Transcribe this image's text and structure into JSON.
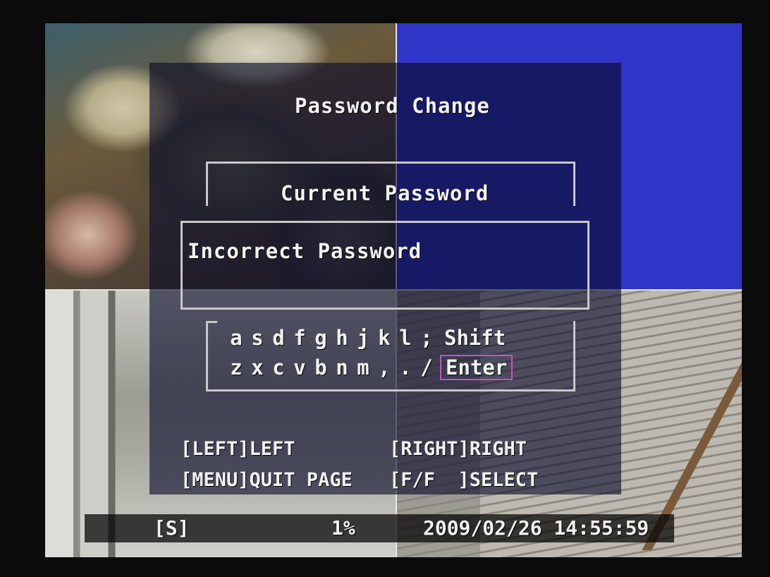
{
  "osd": {
    "title": "Password Change",
    "current_label": "Current Password",
    "password_value": "Incorrect Password"
  },
  "keyboard": {
    "row1": [
      "a",
      "s",
      "d",
      "f",
      "g",
      "h",
      "j",
      "k",
      "l",
      ";"
    ],
    "row1_shift": "Shift",
    "row2": [
      "z",
      "x",
      "c",
      "v",
      "b",
      "n",
      "m",
      ",",
      ".",
      "/"
    ],
    "row2_enter": "Enter"
  },
  "help": {
    "left": "[LEFT]LEFT",
    "right": "[RIGHT]RIGHT",
    "menu": "[MENU]QUIT PAGE",
    "select": "[F/F  ]SELECT"
  },
  "status": {
    "mode": "[S]",
    "usage": "1%",
    "datetime": "2009/02/26 14:55:59"
  },
  "colors": {
    "osd_panel": "#080a28",
    "camera_blue": "#2f36c7",
    "selection_border": "#d04cc8"
  }
}
